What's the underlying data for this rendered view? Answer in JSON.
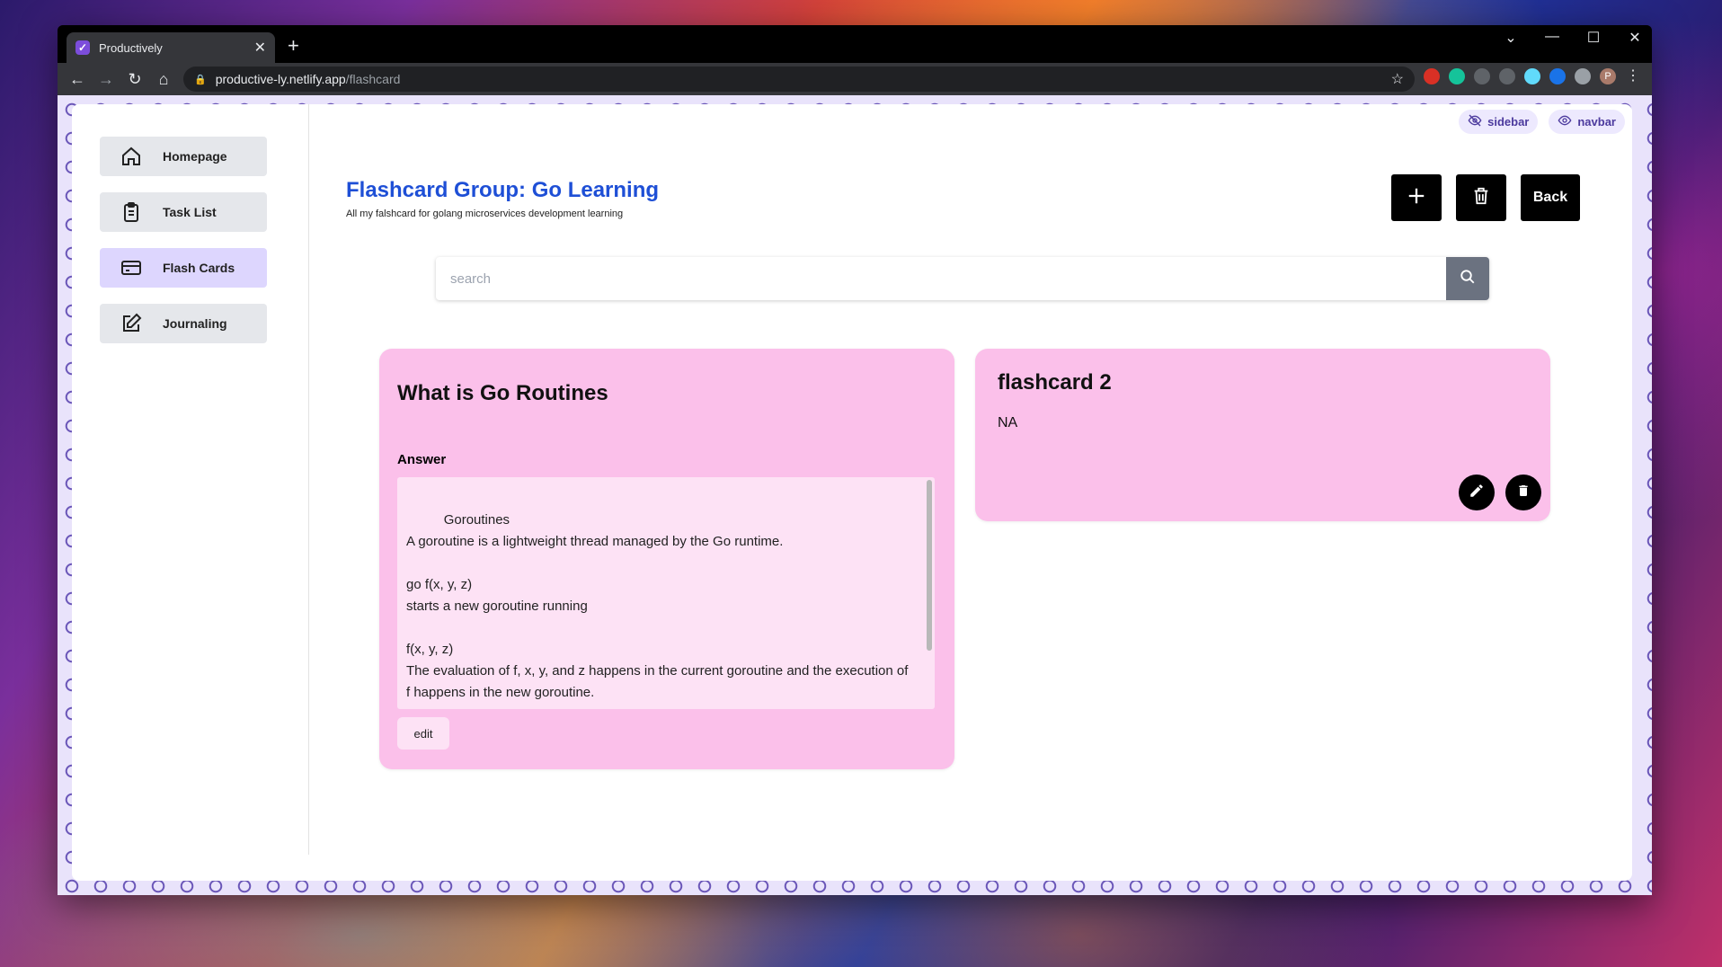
{
  "browser": {
    "tab_title": "Productively",
    "url_host": "productive-ly.netlify.app",
    "url_path": "/flashcard",
    "profile_initial": "P"
  },
  "topbar": {
    "sidebar_toggle": "sidebar",
    "navbar_toggle": "navbar"
  },
  "sidebar": {
    "items": [
      {
        "label": "Homepage",
        "icon": "home-icon"
      },
      {
        "label": "Task List",
        "icon": "clipboard-icon"
      },
      {
        "label": "Flash Cards",
        "icon": "credit-card-icon",
        "active": true
      },
      {
        "label": "Journaling",
        "icon": "edit-icon"
      }
    ]
  },
  "header": {
    "title": "Flashcard Group: Go Learning",
    "description": "All my falshcard for golang microservices development learning",
    "back_label": "Back"
  },
  "search": {
    "placeholder": "search"
  },
  "cards": [
    {
      "title": "What is Go Routines",
      "answer_label": "Answer",
      "answer_text": "Goroutines\nA goroutine is a lightweight thread managed by the Go runtime.\n\ngo f(x, y, z)\nstarts a new goroutine running\n\nf(x, y, z)\nThe evaluation of f, x, y, and z happens in the current goroutine and the execution of f happens in the new goroutine.\n\nGoroutines run in the same address space, so access to shared memory must",
      "edit_label": "edit"
    },
    {
      "title": "flashcard 2",
      "body": "NA"
    }
  ],
  "colors": {
    "accent_blue": "#1e4fd6",
    "card_pink": "#fbc0ea",
    "sidebar_active": "#ddd6fe"
  }
}
